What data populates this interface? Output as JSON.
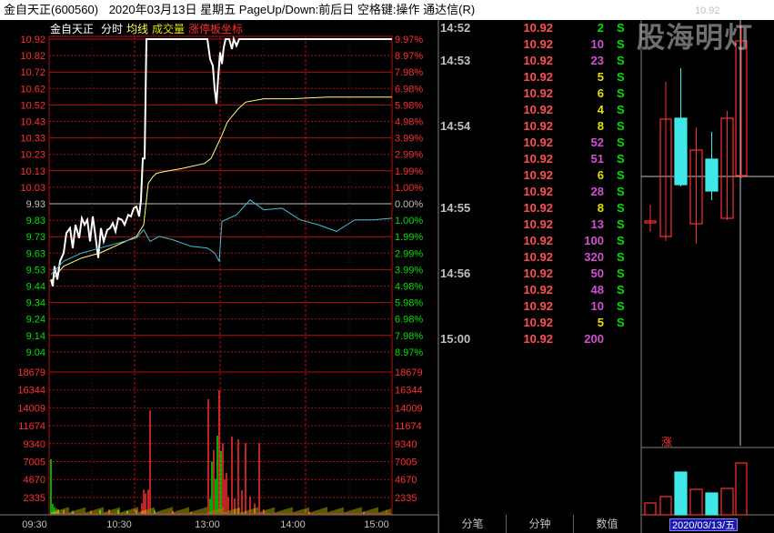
{
  "window": {
    "stock_name": "金自天正",
    "stock_code": "(600560)",
    "date": "2020年03月13日",
    "weekday": "星期五",
    "hint1": "PageUp/Down:前后日",
    "hint2": "空格键:操作",
    "app": "通达信(R)"
  },
  "legend": {
    "name": "金自天正",
    "fenshi": "分时",
    "junxian": "均线",
    "volume": "成交量",
    "limit_label": "涨停板坐标"
  },
  "colors": {
    "up": "#ff3030",
    "down": "#00e000",
    "price_line": "#ffffff",
    "avg_line": "#ffff80",
    "cyan": "#40e0e0",
    "grid": "#b01010"
  },
  "price_axis": {
    "labels": [
      "10.92",
      "10.82",
      "10.72",
      "10.62",
      "10.52",
      "10.43",
      "10.33",
      "10.23",
      "10.13",
      "10.03",
      "9.93",
      "9.83",
      "9.73",
      "9.63",
      "9.53",
      "9.44",
      "9.34",
      "9.24",
      "9.14",
      "9.04"
    ],
    "pct": [
      "9.97%",
      "8.97%",
      "7.98%",
      "6.98%",
      "5.98%",
      "4.98%",
      "3.99%",
      "2.99%",
      "1.99%",
      "1.00%",
      "0.00%",
      "1.00%",
      "1.99%",
      "2.99%",
      "3.99%",
      "4.98%",
      "5.98%",
      "6.98%",
      "7.98%",
      "8.97%"
    ]
  },
  "volume_axis": {
    "labels": [
      "18679",
      "16344",
      "14009",
      "11674",
      "9340",
      "7005",
      "4670",
      "2335"
    ]
  },
  "time_axis": {
    "labels": [
      "09:30",
      "10:30",
      "13:00",
      "14:00",
      "15:00"
    ]
  },
  "ticks": [
    {
      "time": "14:52",
      "price": "10.92",
      "vol": "2",
      "dir": "S",
      "vc": "#00e000"
    },
    {
      "time": "",
      "price": "10.92",
      "vol": "10",
      "dir": "S",
      "vc": "#d050d0"
    },
    {
      "time": "14:53",
      "price": "10.92",
      "vol": "23",
      "dir": "S",
      "vc": "#d050d0"
    },
    {
      "time": "",
      "price": "10.92",
      "vol": "5",
      "dir": "S",
      "vc": "#e0e000"
    },
    {
      "time": "",
      "price": "10.92",
      "vol": "6",
      "dir": "S",
      "vc": "#e0e000"
    },
    {
      "time": "",
      "price": "10.92",
      "vol": "4",
      "dir": "S",
      "vc": "#e0e000"
    },
    {
      "time": "14:54",
      "price": "10.92",
      "vol": "8",
      "dir": "S",
      "vc": "#e0e000"
    },
    {
      "time": "",
      "price": "10.92",
      "vol": "52",
      "dir": "S",
      "vc": "#d050d0"
    },
    {
      "time": "",
      "price": "10.92",
      "vol": "51",
      "dir": "S",
      "vc": "#d050d0"
    },
    {
      "time": "",
      "price": "10.92",
      "vol": "6",
      "dir": "S",
      "vc": "#e0e000"
    },
    {
      "time": "",
      "price": "10.92",
      "vol": "28",
      "dir": "S",
      "vc": "#d050d0"
    },
    {
      "time": "14:55",
      "price": "10.92",
      "vol": "8",
      "dir": "S",
      "vc": "#e0e000"
    },
    {
      "time": "",
      "price": "10.92",
      "vol": "13",
      "dir": "S",
      "vc": "#d050d0"
    },
    {
      "time": "",
      "price": "10.92",
      "vol": "100",
      "dir": "S",
      "vc": "#d050d0"
    },
    {
      "time": "",
      "price": "10.92",
      "vol": "320",
      "dir": "S",
      "vc": "#d050d0"
    },
    {
      "time": "14:56",
      "price": "10.92",
      "vol": "50",
      "dir": "S",
      "vc": "#d050d0"
    },
    {
      "time": "",
      "price": "10.92",
      "vol": "48",
      "dir": "S",
      "vc": "#d050d0"
    },
    {
      "time": "",
      "price": "10.92",
      "vol": "10",
      "dir": "S",
      "vc": "#d050d0"
    },
    {
      "time": "",
      "price": "10.92",
      "vol": "5",
      "dir": "S",
      "vc": "#e0e000"
    },
    {
      "time": "15:00",
      "price": "10.92",
      "vol": "200",
      "dir": "",
      "vc": "#d050d0"
    }
  ],
  "tabs": {
    "fenbi": "分笔",
    "fenzhong": "分钟",
    "shuzhi": "数值"
  },
  "kline": {
    "top_price": "10.92",
    "date": "2020/03/13/五",
    "zhang": "涨"
  },
  "watermark": "股海明灯"
}
